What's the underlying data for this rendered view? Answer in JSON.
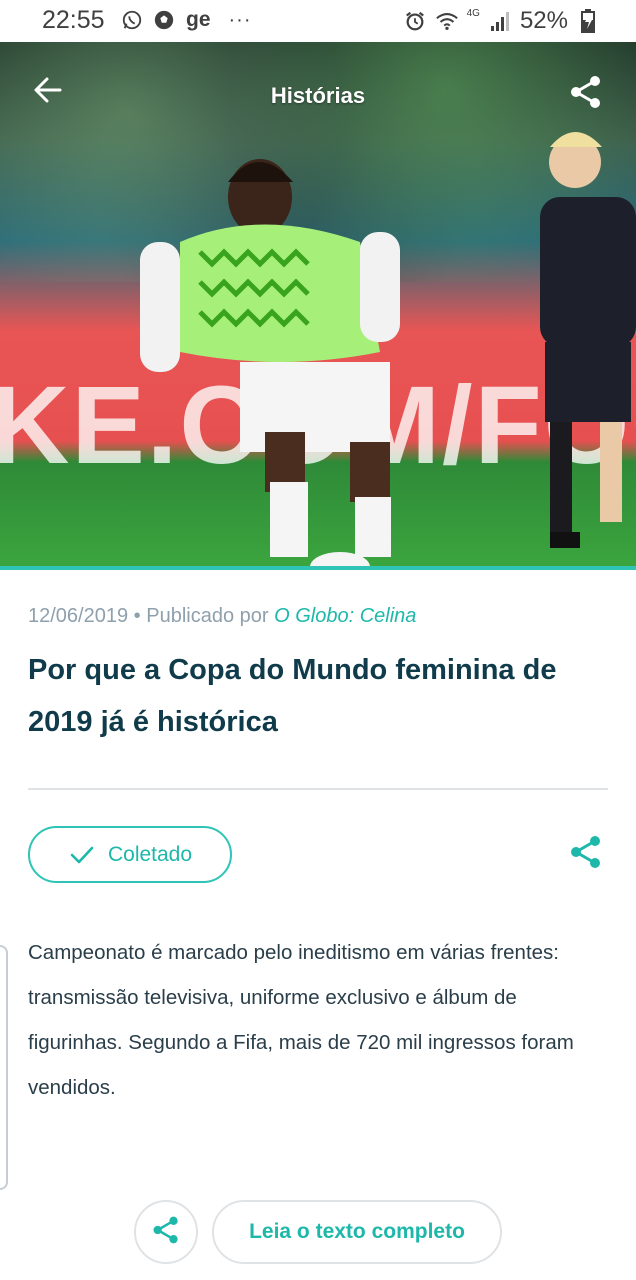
{
  "status_bar": {
    "time": "22:55",
    "ge_label": "ge",
    "more": "···",
    "network": "4G",
    "battery": "52%",
    "left_icons": [
      "whatsapp-icon",
      "soccer-ball-icon"
    ],
    "right_icons": [
      "alarm-icon",
      "wifi-icon",
      "signal-icon",
      "battery-icon"
    ]
  },
  "header": {
    "title": "Histórias",
    "back_icon": "arrow-left-icon",
    "share_icon": "share-icon"
  },
  "hero": {
    "banner_text": "KE.COM/FOO"
  },
  "article": {
    "date": "12/06/2019",
    "separator": " • ",
    "published_by": "Publicado por ",
    "source": "O Globo: Celina",
    "title": "Por que a Copa do Mundo feminina de 2019 já é histórica",
    "summary": "Campeonato é marcado pelo ineditismo em várias frentes: transmissão televisiva, uniforme exclusivo e álbum de figurinhas. Segundo a Fifa, mais de 720 mil ingressos foram vendidos."
  },
  "actions": {
    "collected_label": "Coletado",
    "read_full_label": "Leia o texto completo"
  },
  "colors": {
    "accent": "#2ec4b6",
    "title": "#0f3b4a",
    "meta": "#8fa0ad"
  }
}
